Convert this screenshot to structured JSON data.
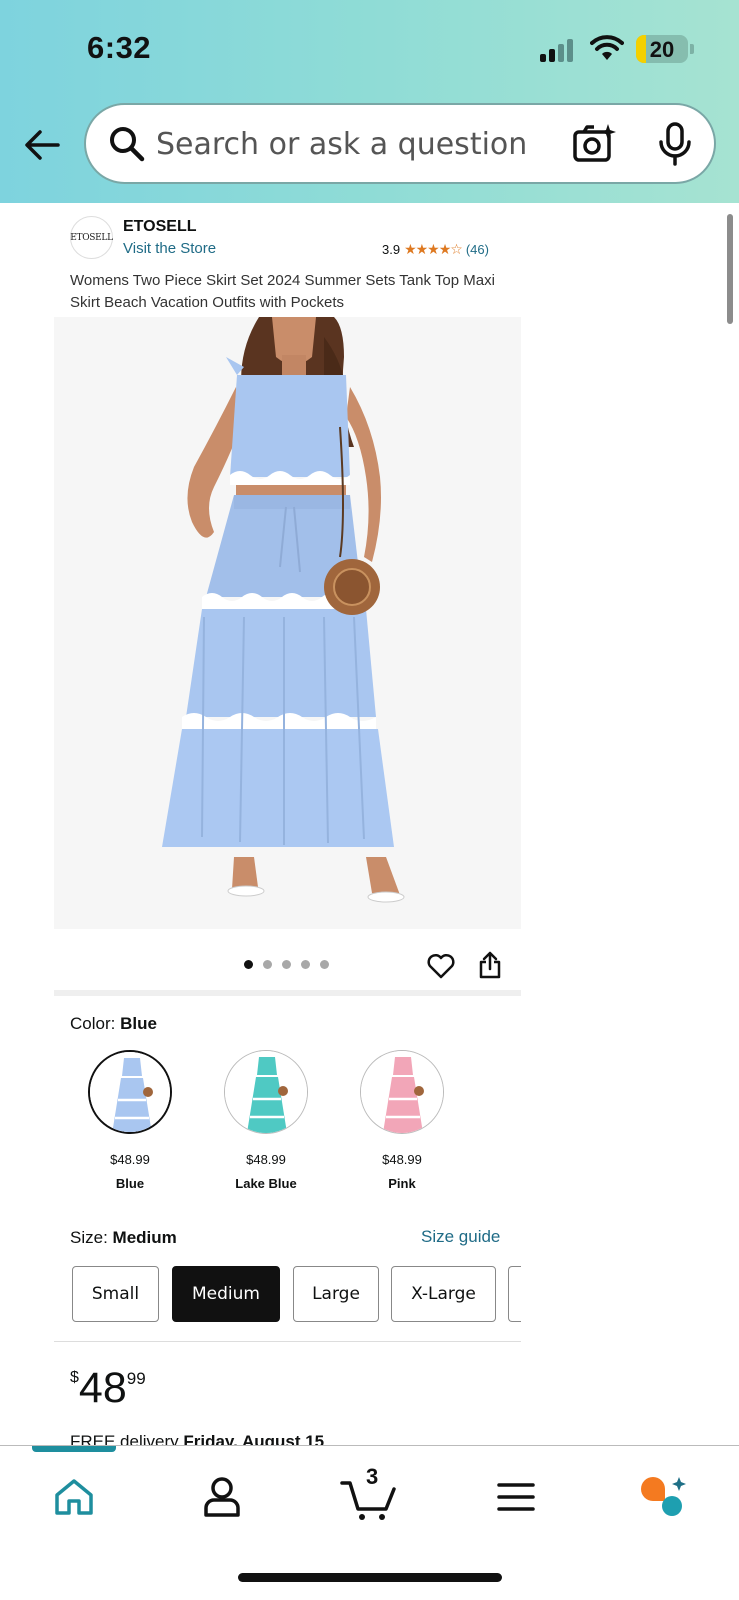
{
  "status_bar": {
    "time": "6:32",
    "battery_level": "20",
    "battery_fraction": 0.2
  },
  "search": {
    "placeholder": "Search or ask a question",
    "value": ""
  },
  "brand": {
    "logo_text": "ETOSELL",
    "name": "ETOSELL",
    "visit_store": "Visit the Store"
  },
  "rating": {
    "value": "3.9",
    "stars": "★★★★☆",
    "count": "(46)"
  },
  "product": {
    "title": "Womens Two Piece Skirt Set 2024 Summer Sets Tank Top Maxi Skirt Beach Vacation Outfits with Pockets",
    "image_count": 5,
    "active_image_index": 0
  },
  "color": {
    "label": "Color:",
    "selected": "Blue",
    "options": [
      {
        "name": "Blue",
        "price": "$48.99",
        "swatch": "#a9c6f0"
      },
      {
        "name": "Lake Blue",
        "price": "$48.99",
        "swatch": "#4fc9c3"
      },
      {
        "name": "Pink",
        "price": "$48.99",
        "swatch": "#f2a6b8"
      }
    ]
  },
  "size": {
    "label": "Size:",
    "selected": "Medium",
    "guide": "Size guide",
    "options": [
      "Small",
      "Medium",
      "Large",
      "X-Large"
    ]
  },
  "price": {
    "currency": "$",
    "whole": "48",
    "fraction": "99"
  },
  "delivery": {
    "prefix": "FREE delivery",
    "date": "Friday, August 15"
  },
  "nav": {
    "items": [
      {
        "name": "home-icon"
      },
      {
        "name": "account-icon"
      },
      {
        "name": "cart-icon",
        "count": "3"
      },
      {
        "name": "menu-icon"
      },
      {
        "name": "rufus-icon"
      }
    ],
    "active": "home"
  },
  "colors": {
    "link": "#1f6b86",
    "star": "#de7921",
    "header_gradient_start": "#7ed3de",
    "header_gradient_end": "#a6e3d2",
    "nav_active": "#1e8e9e"
  }
}
